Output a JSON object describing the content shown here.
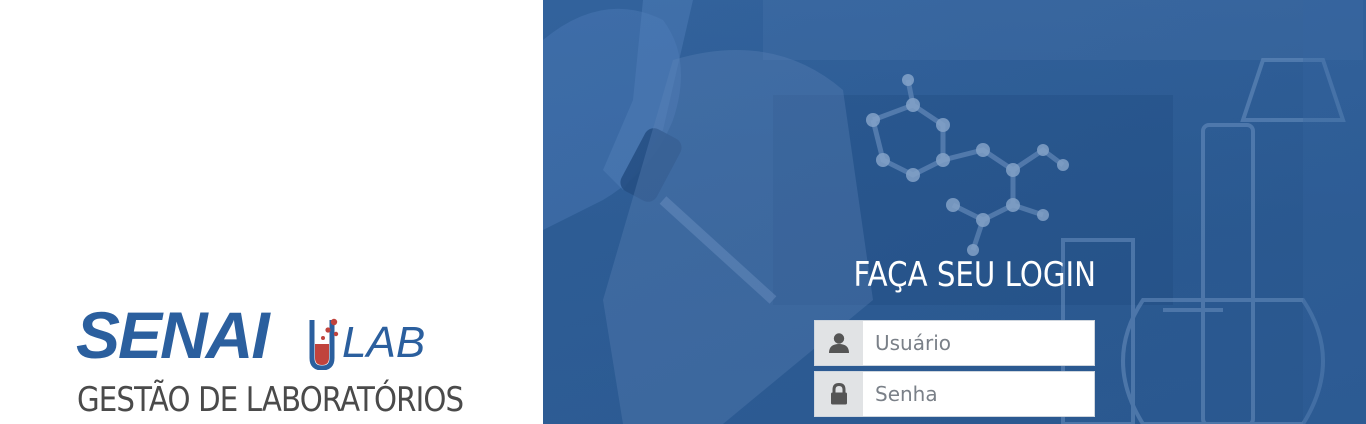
{
  "brand": {
    "name_main": "SENAI",
    "name_suffix": "LAB",
    "tagline": "GESTÃO DE LABORATÓRIOS",
    "primary_color": "#2b5f9e",
    "accent_color": "#c0433d"
  },
  "login": {
    "title": "FAÇA SEU LOGIN",
    "username_placeholder": "Usuário",
    "password_placeholder": "Senha",
    "username_icon": "user-icon",
    "password_icon": "lock-icon"
  },
  "background": {
    "tint_color": "#2c5b93",
    "subject": "laboratory-photo"
  }
}
